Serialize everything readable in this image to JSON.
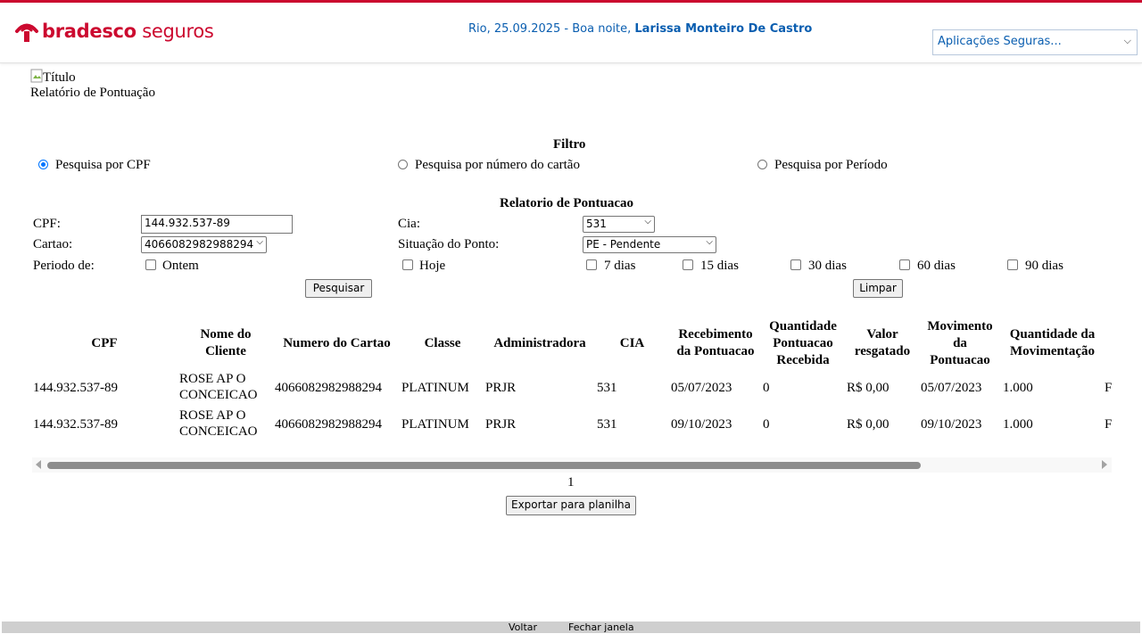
{
  "header": {
    "brand_bold": "bradesco",
    "brand_rest": " seguros",
    "greeting_prefix": "Rio, 25.09.2025 - Boa noite, ",
    "user_name": "Larissa Monteiro De Castro",
    "apps_select_value": "Aplicações Seguras...",
    "accent_color": "#cc092f",
    "link_color": "#0a5eb0"
  },
  "page": {
    "broken_image_alt": "Título",
    "title": "Relatório de Pontuação"
  },
  "filter": {
    "heading": "Filtro",
    "options": [
      {
        "label": "Pesquisa por CPF",
        "selected": true
      },
      {
        "label": "Pesquisa por número do cartão",
        "selected": false
      },
      {
        "label": "Pesquisa por Período",
        "selected": false
      }
    ]
  },
  "form": {
    "heading": "Relatorio de Pontuacao",
    "cpf_label": "CPF:",
    "cpf_value": "144.932.537-89",
    "cartao_label": "Cartao:",
    "cartao_value": "4066082982988294",
    "periodo_label": "Periodo de:",
    "cia_label": "Cia:",
    "cia_value": "531",
    "situacao_label": "Situação do Ponto:",
    "situacao_value": "PE - Pendente",
    "periods": [
      "Ontem",
      "Hoje",
      "7 dias",
      "15 dias",
      "30 dias",
      "60 dias",
      "90 dias"
    ],
    "search_button": "Pesquisar",
    "clear_button": "Limpar"
  },
  "table": {
    "headers": [
      "CPF",
      "Nome do Cliente",
      "Numero do Cartao",
      "Classe",
      "Administradora",
      "CIA",
      "Recebimento da Pontuacao",
      "Quantidade Pontuacao Recebida",
      "Valor resgatado",
      "Movimento da Pontuacao",
      "Quantidade da Movimentação"
    ],
    "rows": [
      [
        "144.932.537-89",
        "ROSE AP O CONCEICAO",
        "4066082982988294",
        "PLATINUM",
        "PRJR",
        "531",
        "05/07/2023",
        "0",
        "R$ 0,00",
        "05/07/2023",
        "1.000",
        "F"
      ],
      [
        "144.932.537-89",
        "ROSE AP O CONCEICAO",
        "4066082982988294",
        "PLATINUM",
        "PRJR",
        "531",
        "09/10/2023",
        "0",
        "R$ 0,00",
        "09/10/2023",
        "1.000",
        "F"
      ]
    ]
  },
  "pagination": {
    "current": "1"
  },
  "export_button": "Exportar para planilha",
  "footer": {
    "back": "Voltar",
    "close": "Fechar janela"
  }
}
